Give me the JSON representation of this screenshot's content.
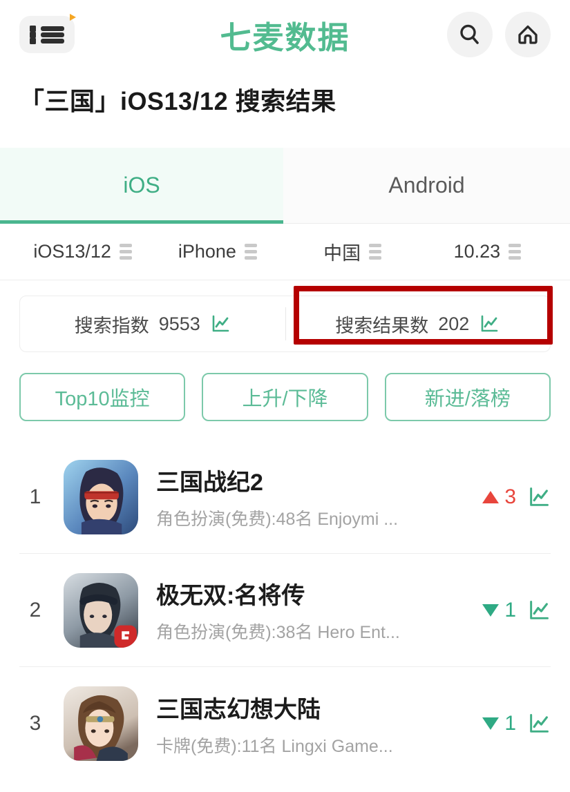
{
  "header": {
    "menu_icon": "list-menu-icon",
    "logo_text": "七麦数据",
    "search_icon": "search-icon",
    "home_icon": "home-icon"
  },
  "page_title": "「三国」iOS13/12 搜索结果",
  "tabs": [
    {
      "label": "iOS",
      "active": true
    },
    {
      "label": "Android",
      "active": false
    }
  ],
  "filters": [
    {
      "label": "iOS13/12",
      "icon": "filter-bars-icon"
    },
    {
      "label": "iPhone",
      "icon": "filter-bars-icon"
    },
    {
      "label": "中国",
      "icon": "filter-bars-icon"
    },
    {
      "label": "10.23",
      "icon": "filter-bars-icon"
    }
  ],
  "stats": [
    {
      "label": "搜索指数",
      "value": "9553",
      "icon": "trend-chart-icon",
      "highlighted": false
    },
    {
      "label": "搜索结果数",
      "value": "202",
      "icon": "trend-chart-icon",
      "highlighted": true
    }
  ],
  "highlight_color": "#b50000",
  "accent_color": "#4bb68f",
  "pills": [
    {
      "label": "Top10监控"
    },
    {
      "label": "上升/下降"
    },
    {
      "label": "新进/落榜"
    }
  ],
  "apps": [
    {
      "rank": "1",
      "name": "三国战纪2",
      "meta": "角色扮演(免费):48名 Enjoymi ...",
      "change_dir": "up",
      "change_value": "3",
      "icon_name": "app-icon-sanguo-zhanji-2"
    },
    {
      "rank": "2",
      "name": "极无双:名将传",
      "meta": "角色扮演(免费):38名 Hero Ent...",
      "change_dir": "down",
      "change_value": "1",
      "icon_name": "app-icon-jiwushuang-mingjiangzhuan"
    },
    {
      "rank": "3",
      "name": "三国志幻想大陆",
      "meta": "卡牌(免费):11名 Lingxi Game...",
      "change_dir": "down",
      "change_value": "1",
      "icon_name": "app-icon-sanguozhi-huanxiang-dalu"
    }
  ]
}
